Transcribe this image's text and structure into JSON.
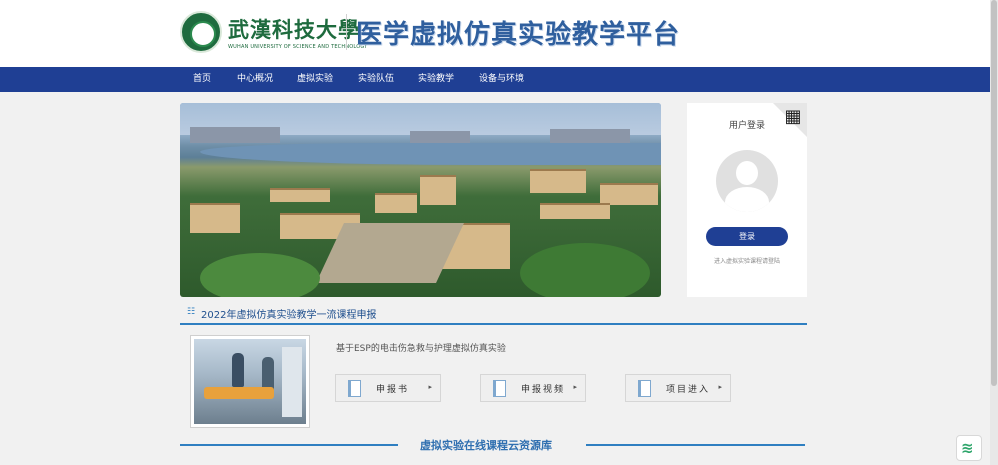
{
  "header": {
    "logo_name": "武漢科技大學",
    "logo_en": "WUHAN UNIVERSITY OF SCIENCE AND TECHNOLOGY",
    "site_title": "医学虚拟仿真实验教学平台"
  },
  "nav": {
    "items": [
      {
        "label": "首页"
      },
      {
        "label": "中心概况"
      },
      {
        "label": "虚拟实验"
      },
      {
        "label": "实验队伍"
      },
      {
        "label": "实验教学"
      },
      {
        "label": "设备与环境"
      }
    ]
  },
  "login": {
    "title": "用户登录",
    "button": "登录",
    "hint": "进入虚拟实验课程请登陆",
    "qr_icon": "qr-code-icon"
  },
  "course_section": {
    "title": "2022年虚拟仿真实验教学一流课程申报",
    "course_name": "基于ESP的电击伤急救与护理虚拟仿真实验",
    "actions": [
      {
        "label": "申报书",
        "caret": "▸"
      },
      {
        "label": "申报视频",
        "caret": "▸"
      },
      {
        "label": "项目进入",
        "caret": "▸"
      }
    ]
  },
  "resource": {
    "title": "虚拟实验在线课程云资源库"
  },
  "colors": {
    "nav_bg": "#1f3f94",
    "accent": "#2f7fc1",
    "brand_green": "#1e6b3e"
  }
}
